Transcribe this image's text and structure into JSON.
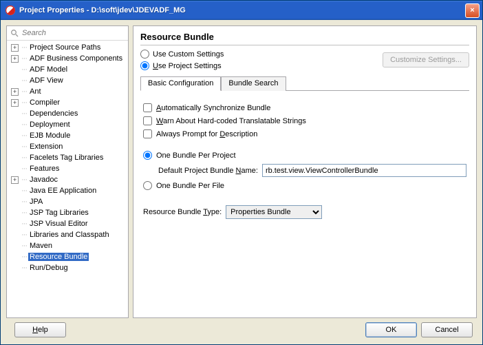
{
  "window": {
    "title": "Project Properties - D:\\soft\\jdev\\JDEVADF_MG",
    "close_icon": "×"
  },
  "sidebar": {
    "search_placeholder": "Search",
    "items": [
      {
        "label": "Project Source Paths",
        "expandable": true
      },
      {
        "label": "ADF Business Components",
        "expandable": true
      },
      {
        "label": "ADF Model",
        "expandable": false
      },
      {
        "label": "ADF View",
        "expandable": false
      },
      {
        "label": "Ant",
        "expandable": true
      },
      {
        "label": "Compiler",
        "expandable": true
      },
      {
        "label": "Dependencies",
        "expandable": false
      },
      {
        "label": "Deployment",
        "expandable": false
      },
      {
        "label": "EJB Module",
        "expandable": false
      },
      {
        "label": "Extension",
        "expandable": false
      },
      {
        "label": "Facelets Tag Libraries",
        "expandable": false
      },
      {
        "label": "Features",
        "expandable": false
      },
      {
        "label": "Javadoc",
        "expandable": true
      },
      {
        "label": "Java EE Application",
        "expandable": false
      },
      {
        "label": "JPA",
        "expandable": false
      },
      {
        "label": "JSP Tag Libraries",
        "expandable": false
      },
      {
        "label": "JSP Visual Editor",
        "expandable": false
      },
      {
        "label": "Libraries and Classpath",
        "expandable": false
      },
      {
        "label": "Maven",
        "expandable": false
      },
      {
        "label": "Resource Bundle",
        "expandable": false,
        "selected": true
      },
      {
        "label": "Run/Debug",
        "expandable": false
      }
    ]
  },
  "main": {
    "heading": "Resource Bundle",
    "use_custom": "Use Custom Settings",
    "use_project": "Use Project Settings",
    "customize_btn": "Customize Settings...",
    "tabs": {
      "basic": "Basic Configuration",
      "search": "Bundle Search"
    },
    "auto_sync": "Automatically Synchronize Bundle",
    "warn_strings": "Warn About Hard-coded Translatable Strings",
    "always_prompt": "Always Prompt for Description",
    "one_per_project": "One Bundle Per Project",
    "default_name_label": "Default Project Bundle Name:",
    "default_name_value": "rb.test.view.ViewControllerBundle",
    "one_per_file": "One Bundle Per File",
    "type_label": "Resource Bundle Type:",
    "type_value": "Properties Bundle"
  },
  "footer": {
    "help": "Help",
    "ok": "OK",
    "cancel": "Cancel"
  }
}
